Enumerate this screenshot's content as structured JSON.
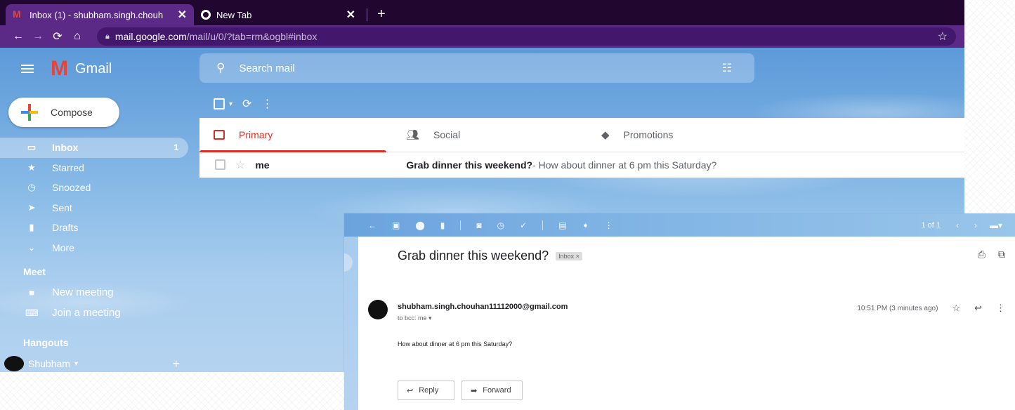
{
  "browser": {
    "tabs": [
      {
        "title": "Inbox (1) - shubham.singh.chouh",
        "close": "✕",
        "icon": "gmail-icon"
      },
      {
        "title": "New Tab",
        "close": "✕",
        "icon": "chrome-icon"
      }
    ],
    "new_tab": "+",
    "url_host": "mail.google.com",
    "url_path": "/mail/u/0/?tab=rm&ogbl#inbox"
  },
  "gmail": {
    "wordmark": "Gmail",
    "compose_label": "Compose",
    "nav": [
      {
        "label": "Inbox",
        "count": "1",
        "icon": "inbox-icon"
      },
      {
        "label": "Starred",
        "count": "",
        "icon": "star-icon"
      },
      {
        "label": "Snoozed",
        "count": "",
        "icon": "clock-icon"
      },
      {
        "label": "Sent",
        "count": "",
        "icon": "send-icon"
      },
      {
        "label": "Drafts",
        "count": "",
        "icon": "draft-icon"
      },
      {
        "label": "More",
        "count": "",
        "icon": "chevron-down-icon"
      }
    ],
    "meet": {
      "title": "Meet",
      "new_meeting": "New meeting",
      "join_meeting": "Join a meeting"
    },
    "hangouts": {
      "title": "Hangouts",
      "user": "Shubham"
    },
    "search_placeholder": "Search mail",
    "tabs": [
      {
        "label": "Primary",
        "icon": "inbox-icon"
      },
      {
        "label": "Social",
        "icon": "people-icon"
      },
      {
        "label": "Promotions",
        "icon": "tag-icon"
      }
    ],
    "row": {
      "sender": "me",
      "subject": "Grab dinner this weekend?",
      "snippet": " - How about dinner at 6 pm this Saturday?"
    }
  },
  "email_view": {
    "pager": "1 of 1",
    "subject": "Grab dinner this weekend?",
    "label_chip": "Inbox ×",
    "sender": "shubham.singh.chouhan11112000@gmail.com",
    "to": "to bcc: me ▾",
    "time": "10:51 PM (3 minutes ago)",
    "body": "How about  dinner at 6 pm this Saturday?",
    "reply_label": "Reply",
    "forward_label": "Forward"
  },
  "colors": {
    "tabstrip": "#210630",
    "toolbar": "#5b2a86",
    "primary_accent": "#d93025"
  }
}
